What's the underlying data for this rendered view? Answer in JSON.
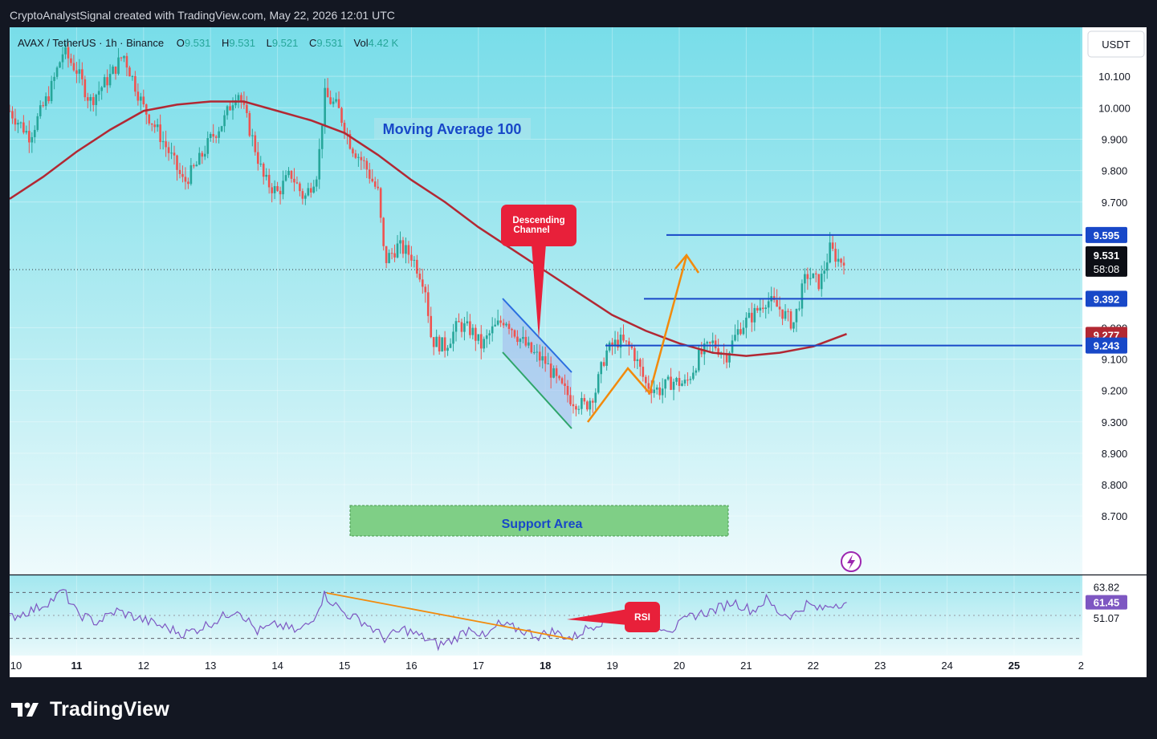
{
  "header": {
    "text": "CryptoAnalystSignal created with TradingView.com, May 22, 2026 12:01 UTC"
  },
  "symbol_bar": {
    "pair": "AVAX / TetherUS · 1h · Binance",
    "o_label": "O",
    "o_value": "9.531",
    "h_label": "H",
    "h_value": "9.531",
    "l_label": "L",
    "l_value": "9.521",
    "c_label": "C",
    "c_value": "9.531",
    "vol_label": "Vol",
    "vol_value": "4.42 K"
  },
  "currency_button": "USDT",
  "annotations": {
    "moving_average": "Moving Average 100",
    "descending_channel": "Descending Channel",
    "support_area": "Support Area",
    "rsi": "RSI"
  },
  "price_tags": {
    "last_price": "9.531",
    "countdown": "58:08",
    "level_high": "9.595",
    "level_mid": "9.392",
    "ma_value": "9.277",
    "level_low": "9.243"
  },
  "rsi_tags": {
    "upper": "63.82",
    "current": "61.45",
    "lower": "51.07"
  },
  "footer": {
    "brand": "TradingView"
  },
  "colors": {
    "background_top": "#7fdfea",
    "background_bottom": "#f2fbfd",
    "bull": "#26a69a",
    "bear": "#ef5350",
    "ma_line": "#b22833",
    "level_line": "#1848c8",
    "arrow": "#f28a0c",
    "callout": "#e8203a",
    "support_fill": "#7fcf86",
    "rsi_line": "#7e57c2"
  },
  "chart_data": {
    "type": "candlestick",
    "symbol": "AVAX / TetherUS",
    "interval": "1h",
    "exchange": "Binance",
    "x_tick_labels": [
      "10",
      "11",
      "12",
      "13",
      "14",
      "15",
      "16",
      "17",
      "18",
      "19",
      "20",
      "21",
      "22",
      "23",
      "24",
      "25",
      "2"
    ],
    "y_tick_labels": [
      "10.100",
      "10.000",
      "9.900",
      "9.800",
      "9.700",
      "9.000",
      "9.100",
      "9.200",
      "9.300",
      "8.900",
      "8.800",
      "8.700"
    ],
    "y_ticks": [
      10.1,
      10.0,
      9.9,
      9.8,
      9.7,
      9.3,
      9.2,
      9.1,
      9.0,
      8.9,
      8.8,
      8.7
    ],
    "ylim": [
      8.615,
      10.195
    ],
    "last_price": 9.531,
    "horizontal_levels": [
      {
        "value": 9.595,
        "color": "#1848c8"
      },
      {
        "value": 9.392,
        "color": "#1848c8"
      },
      {
        "value": 9.243,
        "color": "#1848c8"
      }
    ],
    "ma100_last": 9.277,
    "ma100_path": [
      [
        10.0,
        9.71
      ],
      [
        10.5,
        9.78
      ],
      [
        11.0,
        9.86
      ],
      [
        11.5,
        9.93
      ],
      [
        12.0,
        9.99
      ],
      [
        12.5,
        10.01
      ],
      [
        13.0,
        10.02
      ],
      [
        13.5,
        10.02
      ],
      [
        14.0,
        9.99
      ],
      [
        14.5,
        9.96
      ],
      [
        15.0,
        9.92
      ],
      [
        15.5,
        9.85
      ],
      [
        16.0,
        9.77
      ],
      [
        16.5,
        9.7
      ],
      [
        17.0,
        9.62
      ],
      [
        17.5,
        9.55
      ],
      [
        18.0,
        9.48
      ],
      [
        18.5,
        9.41
      ],
      [
        19.0,
        9.34
      ],
      [
        19.5,
        9.29
      ],
      [
        20.0,
        9.25
      ],
      [
        20.5,
        9.22
      ],
      [
        21.0,
        9.21
      ],
      [
        21.5,
        9.22
      ],
      [
        22.0,
        9.24
      ],
      [
        22.5,
        9.28
      ]
    ],
    "price_path": [
      [
        10.0,
        9.99
      ],
      [
        10.3,
        9.91
      ],
      [
        10.6,
        10.05
      ],
      [
        10.8,
        10.18
      ],
      [
        11.0,
        10.12
      ],
      [
        11.2,
        10.02
      ],
      [
        11.5,
        10.1
      ],
      [
        11.7,
        10.17
      ],
      [
        12.0,
        10.0
      ],
      [
        12.2,
        9.93
      ],
      [
        12.4,
        9.85
      ],
      [
        12.6,
        9.76
      ],
      [
        12.8,
        9.82
      ],
      [
        13.0,
        9.9
      ],
      [
        13.2,
        9.96
      ],
      [
        13.4,
        10.06
      ],
      [
        13.6,
        9.92
      ],
      [
        13.8,
        9.77
      ],
      [
        14.0,
        9.73
      ],
      [
        14.2,
        9.79
      ],
      [
        14.4,
        9.71
      ],
      [
        14.6,
        9.8
      ],
      [
        14.7,
        10.04
      ],
      [
        14.9,
        10.0
      ],
      [
        15.1,
        9.88
      ],
      [
        15.3,
        9.82
      ],
      [
        15.5,
        9.73
      ],
      [
        15.6,
        9.51
      ],
      [
        15.8,
        9.56
      ],
      [
        16.0,
        9.53
      ],
      [
        16.2,
        9.44
      ],
      [
        16.3,
        9.26
      ],
      [
        16.5,
        9.24
      ],
      [
        16.7,
        9.31
      ],
      [
        16.9,
        9.29
      ],
      [
        17.05,
        9.24
      ],
      [
        17.2,
        9.29
      ],
      [
        17.4,
        9.33
      ],
      [
        17.6,
        9.27
      ],
      [
        17.8,
        9.22
      ],
      [
        18.0,
        9.19
      ],
      [
        18.2,
        9.12
      ],
      [
        18.4,
        9.07
      ],
      [
        18.6,
        9.05
      ],
      [
        18.75,
        9.1
      ],
      [
        18.9,
        9.22
      ],
      [
        19.1,
        9.26
      ],
      [
        19.3,
        9.23
      ],
      [
        19.5,
        9.12
      ],
      [
        19.7,
        9.1
      ],
      [
        19.9,
        9.13
      ],
      [
        20.1,
        9.12
      ],
      [
        20.3,
        9.21
      ],
      [
        20.5,
        9.25
      ],
      [
        20.7,
        9.21
      ],
      [
        20.9,
        9.3
      ],
      [
        21.1,
        9.34
      ],
      [
        21.3,
        9.39
      ],
      [
        21.5,
        9.36
      ],
      [
        21.7,
        9.31
      ],
      [
        21.9,
        9.47
      ],
      [
        22.1,
        9.44
      ],
      [
        22.25,
        9.55
      ],
      [
        22.4,
        9.51
      ],
      [
        22.5,
        9.531
      ]
    ],
    "rsi": {
      "tick_labels": [
        "63.82",
        "61.45",
        "51.07"
      ],
      "bands": [
        70,
        30
      ],
      "ylim": [
        15,
        85
      ],
      "values": [
        [
          10.0,
          48
        ],
        [
          10.4,
          56
        ],
        [
          10.7,
          66
        ],
        [
          10.8,
          72
        ],
        [
          11.0,
          52
        ],
        [
          11.3,
          44
        ],
        [
          11.6,
          54
        ],
        [
          11.9,
          48
        ],
        [
          12.2,
          42
        ],
        [
          12.6,
          34
        ],
        [
          12.8,
          38
        ],
        [
          13.1,
          46
        ],
        [
          13.4,
          56
        ],
        [
          13.7,
          36
        ],
        [
          14.0,
          42
        ],
        [
          14.3,
          36
        ],
        [
          14.5,
          44
        ],
        [
          14.7,
          68
        ],
        [
          15.0,
          52
        ],
        [
          15.3,
          44
        ],
        [
          15.6,
          30
        ],
        [
          15.9,
          38
        ],
        [
          16.2,
          30
        ],
        [
          16.4,
          24
        ],
        [
          16.6,
          28
        ],
        [
          16.9,
          40
        ],
        [
          17.1,
          30
        ],
        [
          17.3,
          42
        ],
        [
          17.6,
          38
        ],
        [
          17.9,
          32
        ],
        [
          18.1,
          36
        ],
        [
          18.4,
          30
        ],
        [
          18.6,
          38
        ],
        [
          18.8,
          44
        ],
        [
          19.0,
          48
        ],
        [
          19.3,
          40
        ],
        [
          19.6,
          43
        ],
        [
          19.9,
          38
        ],
        [
          20.2,
          50
        ],
        [
          20.5,
          54
        ],
        [
          20.8,
          62
        ],
        [
          21.1,
          54
        ],
        [
          21.3,
          64
        ],
        [
          21.5,
          52
        ],
        [
          21.7,
          50
        ],
        [
          21.9,
          60
        ],
        [
          22.1,
          55
        ],
        [
          22.3,
          60
        ],
        [
          22.5,
          61.45
        ]
      ]
    }
  }
}
